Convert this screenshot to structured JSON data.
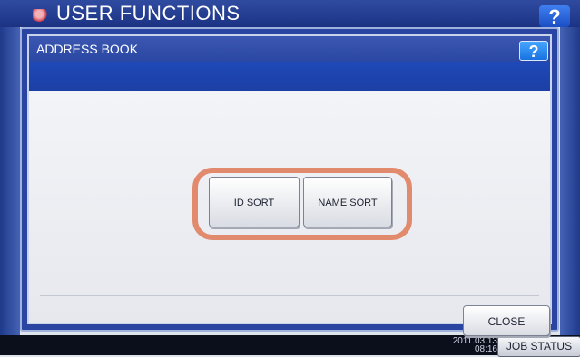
{
  "background": {
    "title": "USER FUNCTIONS",
    "help_label": "?",
    "clock_date": "2011.03.13",
    "clock_time": "08:16",
    "job_status_label": "JOB STATUS"
  },
  "dialog": {
    "title": "ADDRESS BOOK",
    "help_label": "?",
    "buttons": {
      "id_sort": "ID SORT",
      "name_sort": "NAME SORT",
      "close": "CLOSE"
    }
  },
  "colors": {
    "header_blue": "#2f4ba0",
    "highlight_outline": "#e18a6e",
    "help_blue": "#1872e0"
  }
}
